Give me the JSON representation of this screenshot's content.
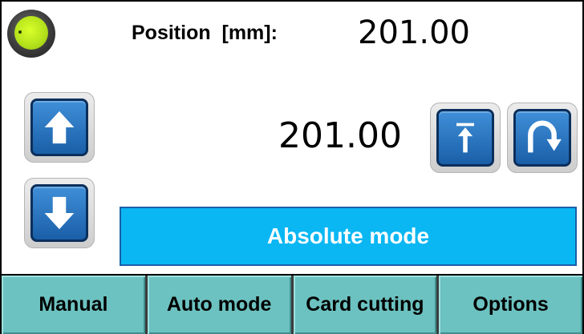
{
  "status": {
    "icon": "status-lamp-icon",
    "color": "#b2e01b"
  },
  "position": {
    "label": "Position  [mm]:",
    "current_value": "201.00"
  },
  "target": {
    "value": "201.00"
  },
  "controls": {
    "up_icon": "arrow-up-icon",
    "down_icon": "arrow-down-icon",
    "home_icon": "move-to-top-icon",
    "return_icon": "u-turn-icon"
  },
  "mode": {
    "label": "Absolute mode",
    "color": "#0ab7f3"
  },
  "tabs": [
    {
      "label": "Manual"
    },
    {
      "label": "Auto mode"
    },
    {
      "label": "Card cutting"
    },
    {
      "label": "Options"
    }
  ],
  "colors": {
    "button_blue": "#1a5fa8",
    "tab_teal": "#6cc2c0"
  }
}
